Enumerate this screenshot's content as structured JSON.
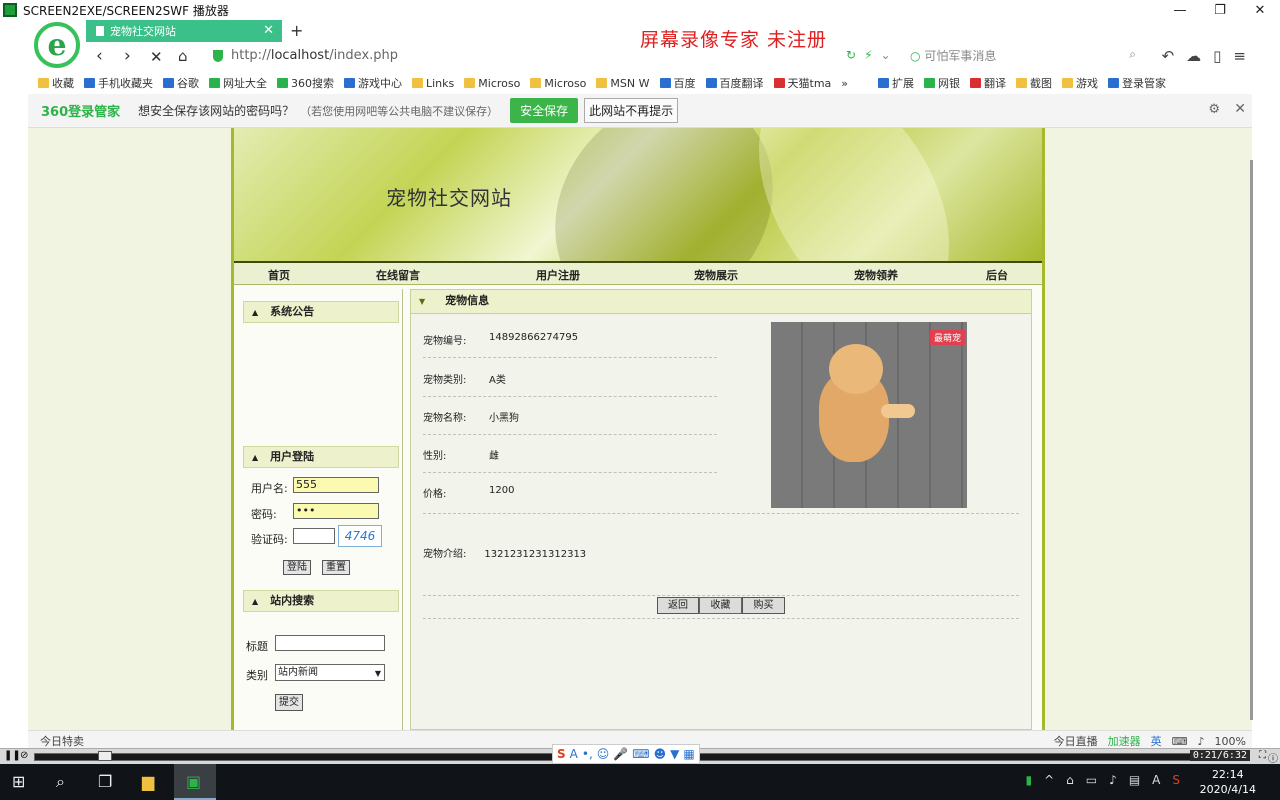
{
  "player": {
    "title": "SCREEN2EXE/SCREEN2SWF 播放器",
    "time": "0:21/6:32",
    "watermark": "屏幕录像专家 未注册"
  },
  "browser": {
    "logo": "e",
    "tab_title": "宠物社交网站",
    "url_prefix": "http://",
    "url_host": "localhost",
    "url_path": "/index.php",
    "search_placeholder": "可怕军事消息",
    "bookmarks": [
      "收藏",
      "手机收藏夹",
      "谷歌",
      "网址大全",
      "360搜索",
      "游戏中心",
      "Links",
      "Microso",
      "Microso",
      "MSN W",
      "百度",
      "百度翻译",
      "天猫tma"
    ],
    "extensions": [
      "扩展",
      "网银",
      "翻译",
      "截图",
      "游戏",
      "登录管家"
    ],
    "status_left": "今日特卖",
    "status_items": [
      "今日直播",
      "加速器",
      "英"
    ],
    "zoom": "100%"
  },
  "password_bar": {
    "brand": "360登录管家",
    "message": "想安全保存该网站的密码吗？",
    "hint": "（若您使用网吧等公共电脑不建议保存）",
    "save_label": "安全保存",
    "never_label": "此网站不再提示"
  },
  "site": {
    "title": "宠物社交网站",
    "nav": [
      "首页",
      "在线留言",
      "用户注册",
      "宠物展示",
      "宠物领养",
      "后台"
    ],
    "notice_title": "系统公告",
    "login_title": "用户登陆",
    "username_label": "用户名:",
    "username_value": "555",
    "password_label": "密码:",
    "password_value": "•••",
    "captcha_label": "验证码:",
    "captcha_value": "",
    "captcha_code": "4746",
    "login_btn": "登陆",
    "reset_btn": "重置",
    "search_title": "站内搜索",
    "search_title_label": "标题",
    "search_title_value": "",
    "search_type_label": "类别",
    "search_type_value": "站内新闻",
    "submit_btn": "提交"
  },
  "pet": {
    "section_title": "宠物信息",
    "fields": [
      {
        "label": "宠物编号:",
        "value": "14892866274795"
      },
      {
        "label": "宠物类别:",
        "value": "A类"
      },
      {
        "label": "宠物名称:",
        "value": "小黑狗"
      },
      {
        "label": "性别:",
        "value": "雌"
      },
      {
        "label": "价格:",
        "value": "1200"
      }
    ],
    "intro_label": "宠物介绍:",
    "intro_value": "1321231231312313",
    "photo_badge": "最萌宠",
    "back_btn": "返回",
    "fav_btn": "收藏",
    "buy_btn": "购买"
  },
  "taskbar": {
    "time": "22:14",
    "date": "2020/4/14"
  },
  "colors": {
    "accent": "#3bb54a",
    "banner": "#b8c83a",
    "watermark": "#e02020"
  }
}
